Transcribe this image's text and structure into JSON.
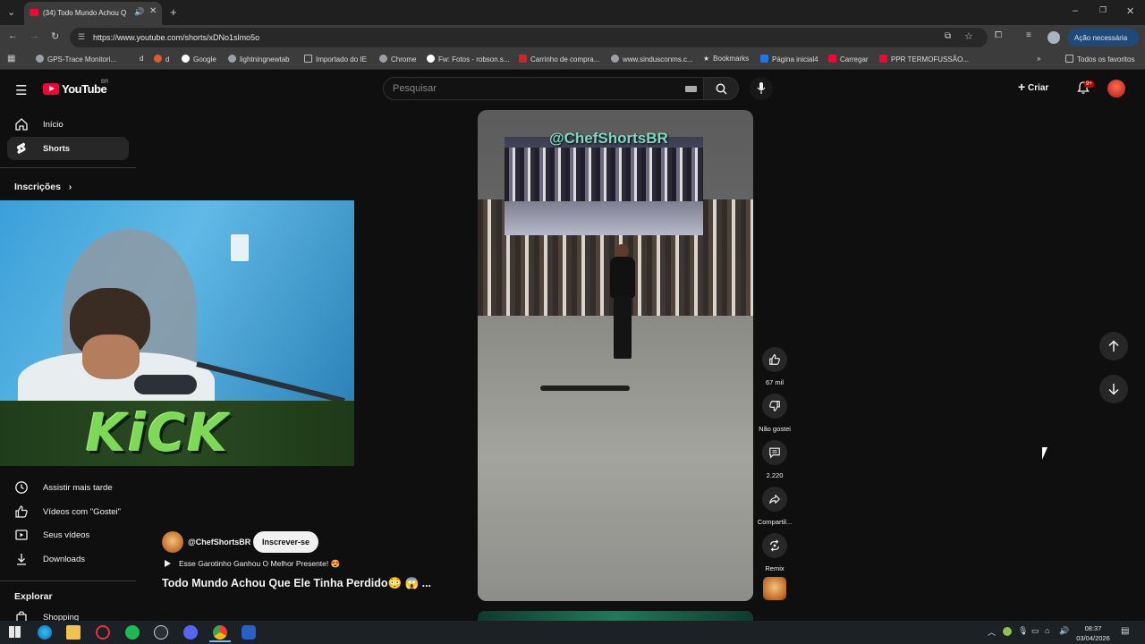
{
  "browser": {
    "tab_title": "(34) Todo Mundo Achou Q",
    "url": "https://www.youtube.com/shorts/xDNo1slmo5o",
    "profile_button": "Ação necessária",
    "bookmarks": [
      "GPS-Trace Monitori...",
      "d",
      "d",
      "Google",
      "lightningnewtab",
      "Importado do IE",
      "Chrome",
      "Fw: Fotos - robson.s...",
      "Carrinho de compra...",
      "www.sindusconms.c...",
      "Bookmarks",
      "Página inicial4",
      "Carregar",
      "PPR TERMOFUSSÃO...",
      "Todos os favoritos"
    ]
  },
  "header": {
    "logo_text": "YouTube",
    "logo_region": "BR",
    "search_placeholder": "Pesquisar",
    "create_label": "Criar",
    "notification_count": "9+"
  },
  "sidebar": {
    "home_label": "Início",
    "shorts_label": "Shorts",
    "subscriptions_label": "Inscrições",
    "watch_later_label": "Assistir mais tarde",
    "liked_label": "Vídeos com \"Gostei\"",
    "your_videos_label": "Seus vídeos",
    "downloads_label": "Downloads",
    "explore_label": "Explorar",
    "shopping_label": "Shopping"
  },
  "overlay": {
    "banner_text": "KiCK"
  },
  "video": {
    "handle_overlay": "@ChefShortsBR",
    "channel": "@ChefShortsBR",
    "subscribe_label": "Inscrever-se",
    "song": "Esse Garotinho Ganhou O Melhor Presente! 😍",
    "title": "Todo Mundo Achou Que Ele Tinha Perdido😳 😱 ..."
  },
  "actions": {
    "likes": "67 mil",
    "dislike_label": "Não gostei",
    "comments": "2.220",
    "share_label": "Compartil...",
    "remix_label": "Remix"
  },
  "taskbar": {
    "time": "08:37",
    "date": "03/04/2026"
  }
}
